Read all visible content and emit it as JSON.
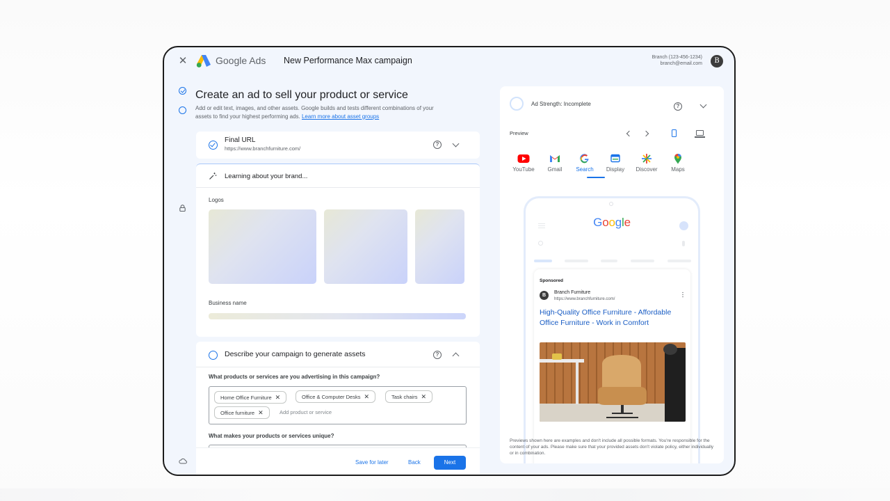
{
  "header": {
    "brand": "Google Ads",
    "campaign_title": "New Performance Max campaign",
    "account_line1": "Branch (123-456-1234)",
    "account_line2": "branch@email.com",
    "avatar_letter": "B"
  },
  "main": {
    "title": "Create an ad to sell your product or service",
    "description": "Add or edit text, images, and other assets. Google builds and tests different combinations of your assets to find your highest performing ads.",
    "learn_more_link": "Learn more about asset groups",
    "final_url": {
      "label": "Final URL",
      "value": "https://www.branchfurniture.com/"
    },
    "learning": {
      "label": "Learning about your brand...",
      "logos_label": "Logos",
      "business_name_label": "Business name"
    },
    "describe": {
      "title": "Describe your campaign to generate assets",
      "question1": "What products or services are you advertising in this campaign?",
      "chips": [
        "Home Office Furniture",
        "Office & Computer Desks",
        "Task chairs",
        "Office furniture"
      ],
      "add_placeholder": "Add product or service",
      "question2": "What makes your products or services unique?"
    },
    "footer": {
      "save_for_later": "Save for later",
      "back": "Back",
      "next": "Next"
    }
  },
  "preview_panel": {
    "ad_strength": "Ad Strength: Incomplete",
    "preview_label": "Preview",
    "formats": [
      {
        "label": "YouTube",
        "icon": "youtube-icon"
      },
      {
        "label": "Gmail",
        "icon": "gmail-icon"
      },
      {
        "label": "Search",
        "icon": "google-g-icon"
      },
      {
        "label": "Display",
        "icon": "display-icon"
      },
      {
        "label": "Discover",
        "icon": "discover-icon"
      },
      {
        "label": "Maps",
        "icon": "maps-pin-icon"
      }
    ],
    "active_format": "Search",
    "phone": {
      "google_logo": "Google",
      "sponsored": "Sponsored",
      "advertiser_initial": "B",
      "advertiser_name": "Branch Furniture",
      "advertiser_url": "https://www.branchfurniture.com/",
      "headline": "High-Quality Office Furniture - Affordable Office Furniture - Work in Comfort"
    },
    "disclaimer": "Previews shown here are examples and don't include all possible formats. You're responsible for the content of your ads. Please make sure that your provided assets don't violate policy, either individually or in combination."
  },
  "colors": {
    "accent": "#1a73e8",
    "frame_bg": "#f2f6fd",
    "headline_link": "#1a5dc4"
  }
}
